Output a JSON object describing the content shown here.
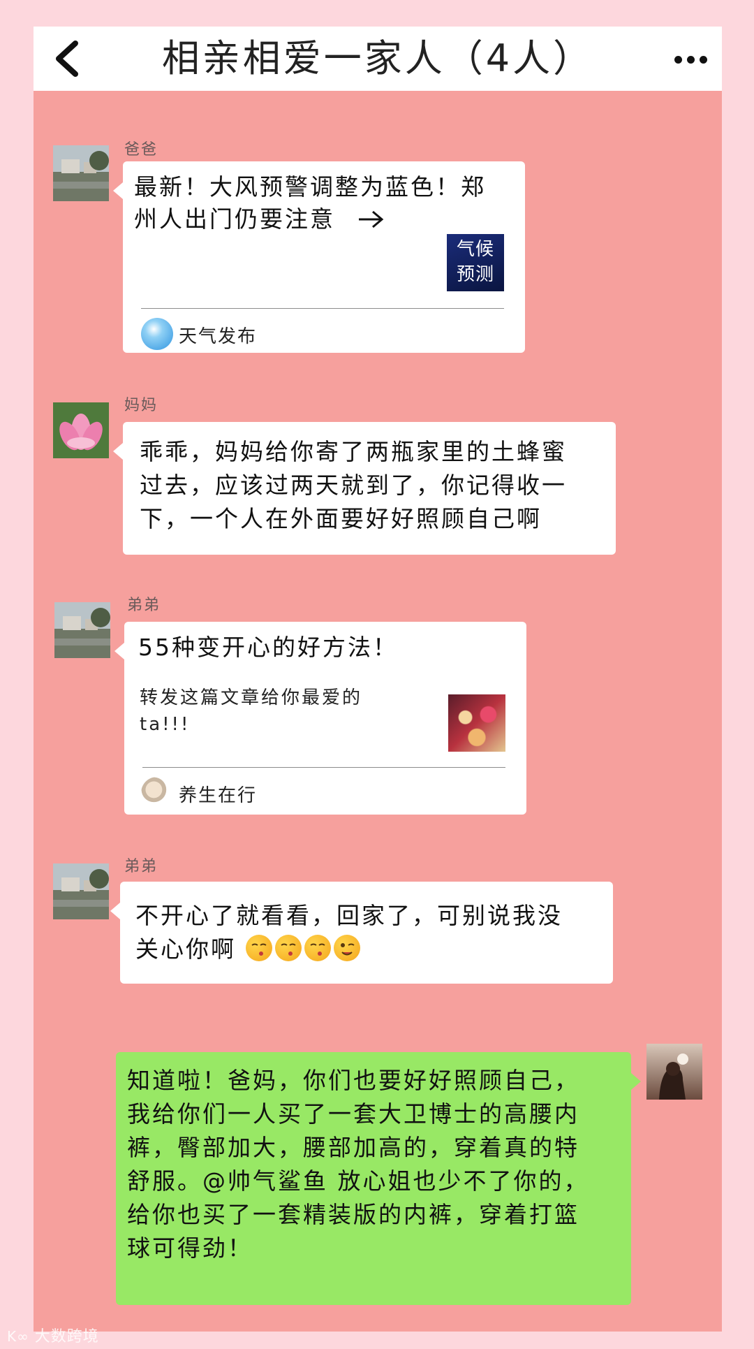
{
  "header": {
    "title": "相亲相爱一家人（4人）"
  },
  "messages": [
    {
      "sender": "爸爸",
      "type": "link-card",
      "title_lines": [
        "最新！大风预警调整为蓝色！郑",
        "州人出门仍要注意"
      ],
      "thumb_text": [
        "气候",
        "预测"
      ],
      "source": "天气发布"
    },
    {
      "sender": "妈妈",
      "type": "text",
      "lines": [
        "乖乖，妈妈给你寄了两瓶家里的土蜂蜜",
        "过去，应该过两天就到了，你记得收一",
        "下，一个人在外面要好好照顾自己啊"
      ]
    },
    {
      "sender": "弟弟",
      "type": "link-card",
      "title": "55种变开心的好方法！",
      "desc_lines": [
        "转发这篇文章给你最爱的",
        "ta!!!"
      ],
      "source": "养生在行"
    },
    {
      "sender": "弟弟",
      "type": "text",
      "lines": [
        "不开心了就看看，回家了，可别说我没",
        "关心你啊"
      ],
      "emojis": [
        "kiss-emoji",
        "kiss-emoji",
        "kiss-emoji",
        "wink-emoji"
      ]
    },
    {
      "sender": "me",
      "type": "text",
      "lines": [
        "知道啦！爸妈，你们也要好好照顾自己，",
        "我给你们一人买了一套大卫博士的高腰内",
        "裤，臀部加大，腰部加高的，穿着真的特",
        "舒服。@帅气鲨鱼 放心姐也少不了你的，",
        "给你也买了一套精装版的内裤，穿着打篮",
        "球可得劲！"
      ]
    }
  ],
  "watermark": "大数跨境",
  "colors": {
    "page_bg": "#fdd7dd",
    "chat_bg": "#f6a09d",
    "bubble_other": "#ffffff",
    "bubble_mine": "#98e865"
  }
}
